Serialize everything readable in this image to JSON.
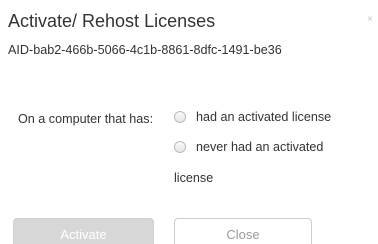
{
  "dialog": {
    "title": "Activate/ Rehost Licenses",
    "close_glyph": "×",
    "subtitle": "AID-bab2-466b-5066-4c1b-8861-8dfc-1491-be36"
  },
  "form": {
    "label": "On a computer that has:",
    "options": [
      {
        "label": "had an activated license"
      },
      {
        "label": "never had an activated"
      }
    ],
    "option_wrap": "license"
  },
  "buttons": {
    "activate": "Activate",
    "close": "Close"
  },
  "icons": {
    "close": "close-x-icon",
    "radio": "radio-unchecked-icon"
  },
  "colors": {
    "activate_bg": "#d7d7d7",
    "text": "#333333"
  }
}
